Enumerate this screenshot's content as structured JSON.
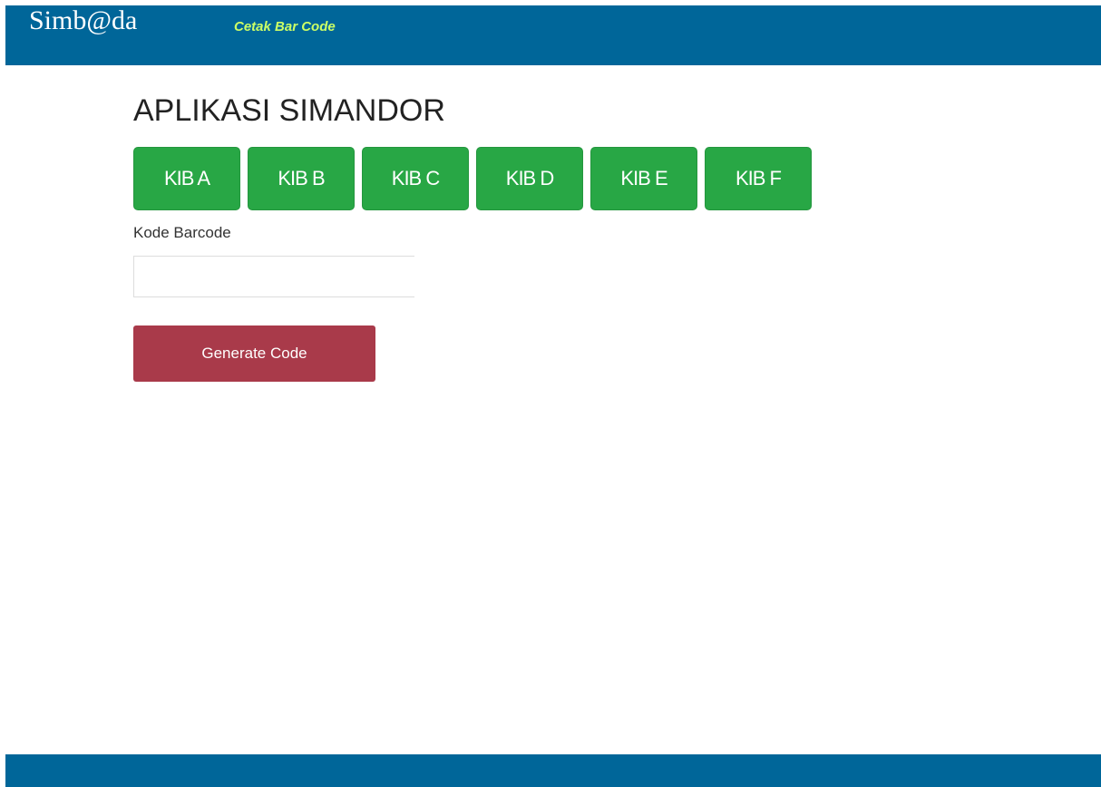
{
  "header": {
    "brand": "Simb@da",
    "subtitle": "Cetak Bar Code"
  },
  "main": {
    "title": "APLIKASI SIMANDOR",
    "kib_buttons": [
      "KIB A",
      "KIB B",
      "KIB C",
      "KIB D",
      "KIB E",
      "KIB F"
    ],
    "barcode_label": "Kode Barcode",
    "barcode_value": "",
    "generate_label": "Generate Code"
  },
  "colors": {
    "header_bg": "#006699",
    "subtitle": "#ccff66",
    "kib_button": "#28a745",
    "generate_button": "#a93a4a"
  }
}
